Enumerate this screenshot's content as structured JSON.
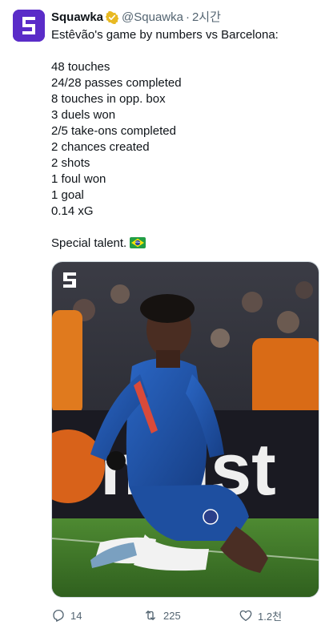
{
  "account": {
    "display_name": "Squawka",
    "handle": "@Squawka",
    "separator": "·",
    "time": "2시간",
    "verified": true,
    "brand_color": "#5a2cc8",
    "logo_icon": "squawka-s-logo"
  },
  "tweet": {
    "lines": [
      "Estêvão's game by numbers vs Barcelona:",
      "",
      "48 touches",
      "24/28 passes completed",
      "8 touches in opp. box",
      "3 duels won",
      "2/5 take-ons completed",
      "2 chances created",
      "2 shots",
      "1 foul won",
      "1 goal",
      "0.14 xG",
      "",
      "Special talent."
    ],
    "closing_emoji": "brazil-flag"
  },
  "media": {
    "alt": "Chelsea player celebrating on his knees",
    "kit_color": "#1e4fa0"
  },
  "actions": {
    "replies": "14",
    "reposts": "225",
    "likes": "1.2천"
  }
}
